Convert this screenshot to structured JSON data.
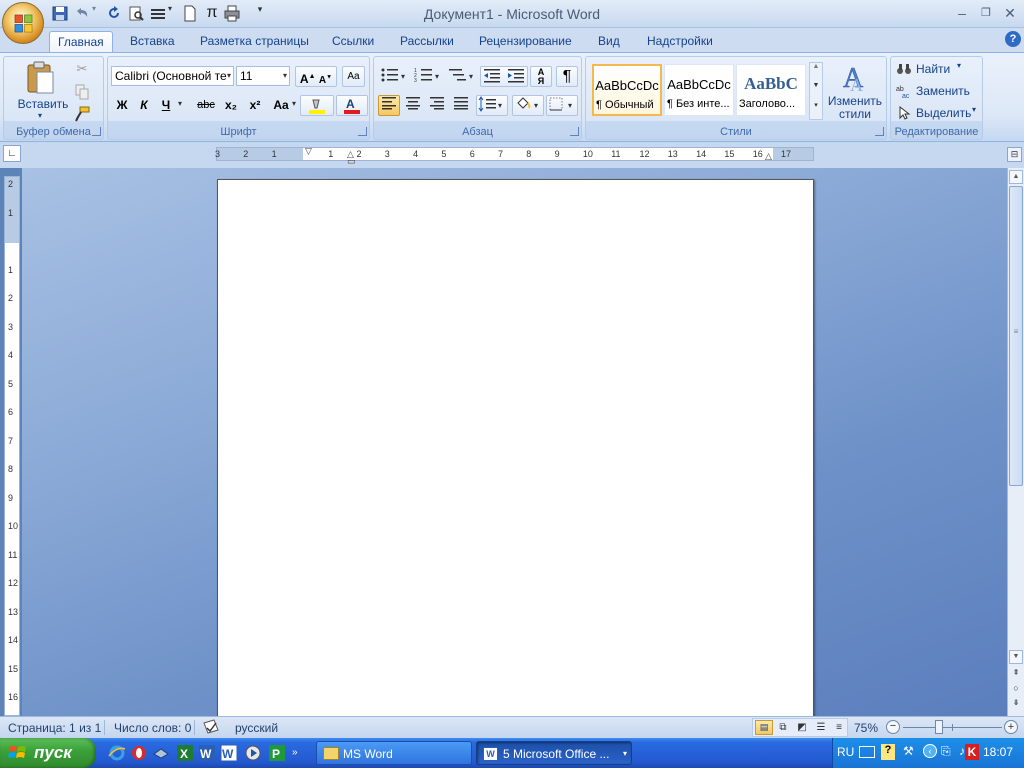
{
  "window": {
    "title": "Документ1 - Microsoft Word"
  },
  "tabs": [
    "Главная",
    "Вставка",
    "Разметка страницы",
    "Ссылки",
    "Рассылки",
    "Рецензирование",
    "Вид",
    "Надстройки"
  ],
  "ribbon": {
    "clipboard": {
      "label": "Буфер обмена",
      "paste": "Вставить"
    },
    "font": {
      "label": "Шрифт",
      "font_name": "Calibri (Основной те",
      "font_size": "11",
      "bold": "Ж",
      "italic": "К",
      "underline": "Ч",
      "strike": "abc",
      "sub": "x₂",
      "sup": "x²",
      "case": "Aa"
    },
    "paragraph": {
      "label": "Абзац"
    },
    "styles": {
      "label": "Стили",
      "cards": [
        {
          "sample": "AaBbCcDc",
          "name": "¶ Обычный"
        },
        {
          "sample": "AaBbCcDc",
          "name": "¶ Без инте..."
        },
        {
          "sample": "AaBbC",
          "name": "Заголово..."
        }
      ],
      "change": "Изменить стили"
    },
    "editing": {
      "label": "Редактирование",
      "find": "Найти",
      "replace": "Заменить",
      "select": "Выделить"
    }
  },
  "status": {
    "page": "Страница: 1 из 1",
    "words": "Число слов: 0",
    "lang": "русский",
    "zoom": "75%"
  },
  "taskbar": {
    "start": "пуск",
    "tasks": [
      "MS Word",
      "5 Microsoft Office ..."
    ],
    "lang": "RU",
    "time": "18:07"
  },
  "ruler_h": [
    "3",
    "2",
    "1",
    "",
    "1",
    "2",
    "3",
    "4",
    "5",
    "6",
    "7",
    "8",
    "9",
    "10",
    "11",
    "12",
    "13",
    "14",
    "15",
    "16",
    "17"
  ],
  "ruler_v": [
    "2",
    "1",
    "",
    "1",
    "2",
    "3",
    "4",
    "5",
    "6",
    "7",
    "8",
    "9",
    "10",
    "11",
    "12",
    "13",
    "14",
    "15",
    "16"
  ]
}
